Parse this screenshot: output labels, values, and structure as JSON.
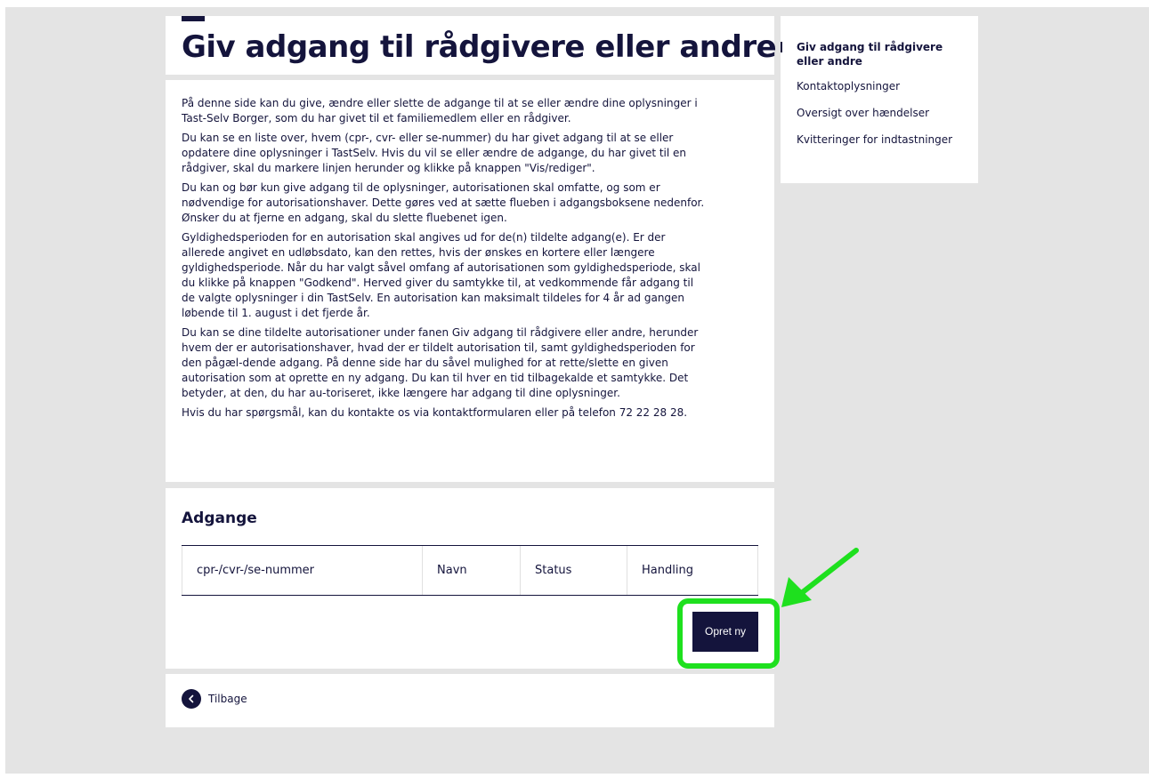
{
  "page": {
    "title": "Giv adgang til rådgivere eller andre"
  },
  "intro": {
    "paragraphs": [
      "På denne side kan du give, ændre eller slette de adgange til at se eller ændre dine oplysninger i Tast-Selv Borger, som du har givet til et familiemedlem eller en rådgiver.",
      "Du kan se en liste over, hvem (cpr-, cvr- eller se-nummer) du har givet adgang til at se eller opdatere dine oplysninger i TastSelv. Hvis du vil se eller ændre de adgange, du har givet til en rådgiver, skal du markere linjen herunder og klikke på knappen \"Vis/rediger\".",
      "Du kan og bør kun give adgang til de oplysninger, autorisationen skal omfatte, og som er nødvendige for autorisationshaver. Dette gøres ved at sætte flueben i adgangsboksene nedenfor. Ønsker du at fjerne en adgang, skal du slette fluebenet igen.",
      "Gyldighedsperioden for en autorisation skal angives ud for de(n) tildelte adgang(e). Er der allerede angivet en udløbsdato, kan den rettes, hvis der ønskes en kortere eller længere gyldighedsperiode. Når du har valgt såvel omfang af autorisationen som gyldighedsperiode, skal du klikke på knappen \"Godkend\". Herved giver du samtykke til, at vedkommende får adgang til de valgte oplysninger i din TastSelv. En autorisation kan maksimalt tildeles for 4 år ad gangen løbende til 1. august i det fjerde år.",
      "Du kan se dine tildelte autorisationer under fanen Giv adgang til rådgivere eller andre, herunder hvem der er autorisationshaver, hvad der er tildelt autorisation til, samt gyldighedsperioden for den pågæl-dende adgang. På denne side har du såvel mulighed for at rette/slette en given autorisation som at oprette en ny adgang. Du kan til hver en tid tilbagekalde et samtykke. Det betyder, at den, du har au-toriseret, ikke længere har adgang til dine oplysninger.",
      "Hvis du har spørgsmål, kan du kontakte os via kontaktformularen eller på telefon 72 22 28 28."
    ]
  },
  "access": {
    "heading": "Adgange",
    "columns": [
      "cpr-/cvr-/se-nummer",
      "Navn",
      "Status",
      "Handling"
    ],
    "create_button": "Opret ny"
  },
  "back": {
    "label": "Tilbage",
    "icon": "chevron-left-icon"
  },
  "sidenav": {
    "items": [
      {
        "label": "Giv adgang til rådgivere eller andre",
        "active": true
      },
      {
        "label": "Kontaktoplysninger",
        "active": false
      },
      {
        "label": "Oversigt over hændelser",
        "active": false
      },
      {
        "label": "Kvitteringer for indtastninger",
        "active": false
      }
    ]
  },
  "colors": {
    "primary": "#14143c",
    "background": "#e4e4e4",
    "highlight": "#1ee01e"
  }
}
